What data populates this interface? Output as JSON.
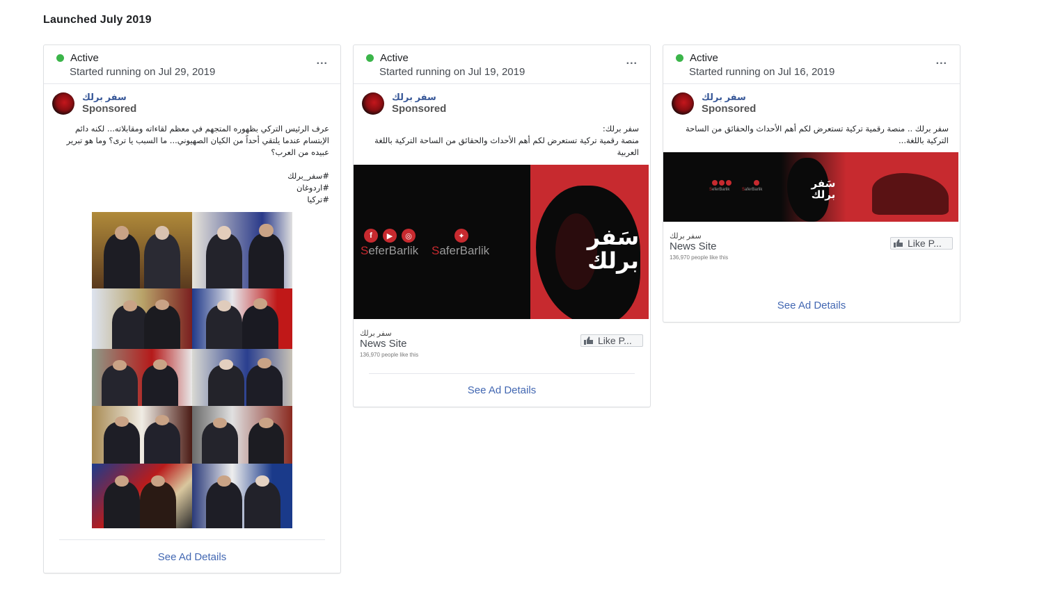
{
  "section_title": "Launched July 2019",
  "cards": [
    {
      "status": "Active",
      "started": "Started running on Jul 29, 2019",
      "more": "...",
      "page_name": "سفر برلك",
      "sponsored": "Sponsored",
      "text": "عرف الرئيس التركي بظهوره المتجهم في معظم لقاءاته ومقابلاته... لكنه دائم الإبتسام عندما يلتقي أحداً من الكيان الصهيوني... ما السبب يا ترى؟ وما هو تبرير عبيده من العرب؟\n\n#سفر_برلك\n#اردوغان\n#تركيا",
      "see_details": "See Ad Details"
    },
    {
      "status": "Active",
      "started": "Started running on Jul 19, 2019",
      "more": "...",
      "page_name": "سفر برلك",
      "sponsored": "Sponsored",
      "text": "سفر برلك:\nمنصة رقمية تركية تستعرض لكم أهم الأحداث والحقائق من الساحة التركية باللغة العربية",
      "banner": {
        "handle_1": "SeferBarlik",
        "handle_2": "SaferBarlik",
        "logo_line_1": "سَفر",
        "logo_line_2": "برلك",
        "social_icons": [
          "facebook-icon",
          "youtube-icon",
          "instagram-icon",
          "twitter-icon"
        ]
      },
      "cta_small": "سفر برلك",
      "cta_category": "News Site",
      "cta_likes": "136,970 people like this",
      "like_label": "Like P...",
      "see_details": "See Ad Details"
    },
    {
      "status": "Active",
      "started": "Started running on Jul 16, 2019",
      "more": "...",
      "page_name": "سفر برلك",
      "sponsored": "Sponsored",
      "text": "سفر برلك .. منصة رقمية تركية تستعرض لكم أهم الأحداث والحقائق من الساحة التركية باللغة...",
      "banner": {
        "handle_1": "SeferBarlik",
        "handle_2": "SaferBarlik",
        "logo_line_1": "سَفر",
        "logo_line_2": "برلك"
      },
      "cta_small": "سفر برلك",
      "cta_category": "News Site",
      "cta_likes": "136,970 people like this",
      "like_label": "Like P...",
      "see_details": "See Ad Details"
    }
  ],
  "colors": {
    "active_dot": "#3bb54a",
    "link": "#4267b2",
    "brand_red": "#c72a2f"
  }
}
